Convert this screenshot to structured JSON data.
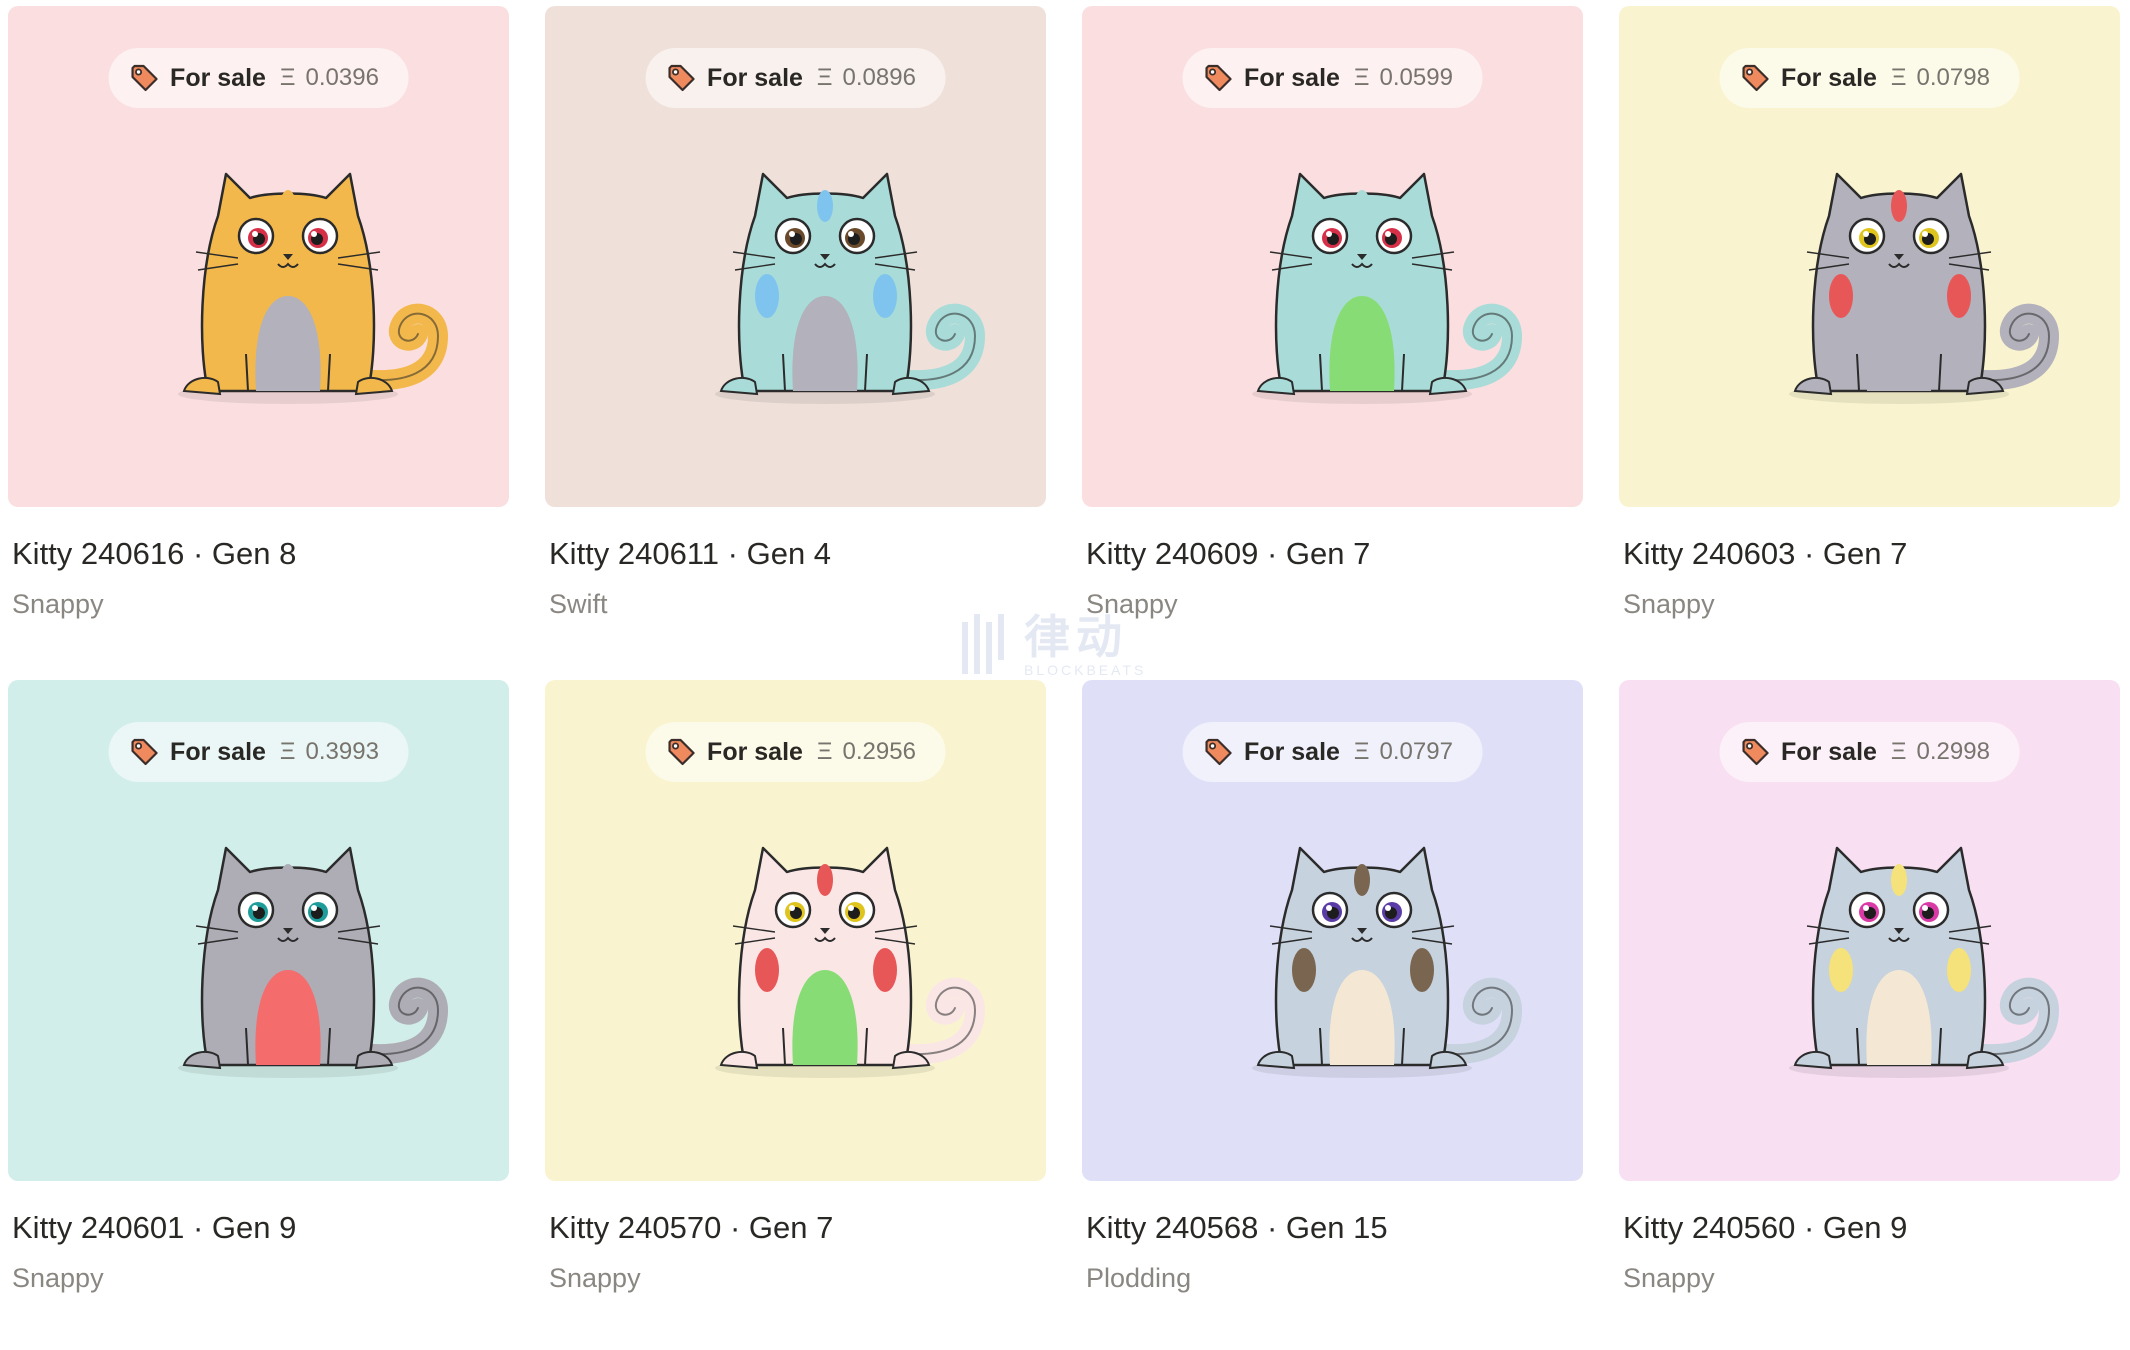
{
  "currency_symbol": "Ξ",
  "for_sale_label": "For sale",
  "watermark": {
    "text": "律动",
    "sub": "BLOCKBEATS"
  },
  "kitties": [
    {
      "title": "Kitty 240616 · Gen 8",
      "speed": "Snappy",
      "price": "0.0396",
      "bg": "#fbdfe0",
      "body": "#f3b84b",
      "belly": "#b3b1bb",
      "eyes": "#d63048",
      "pattern": "#f3b84b"
    },
    {
      "title": "Kitty 240611 · Gen 4",
      "speed": "Swift",
      "price": "0.0896",
      "bg": "#efe0da",
      "body": "#a9dcd8",
      "belly": "#b3b1bb",
      "eyes": "#6b4a2c",
      "pattern": "#7ec4ee"
    },
    {
      "title": "Kitty 240609 · Gen 7",
      "speed": "Snappy",
      "price": "0.0599",
      "bg": "#fbdfe0",
      "body": "#a9dcd8",
      "belly": "#88dc76",
      "eyes": "#d63048",
      "pattern": "#a9dcd8"
    },
    {
      "title": "Kitty 240603 · Gen 7",
      "speed": "Snappy",
      "price": "0.0798",
      "bg": "#f9f4cf",
      "body": "#b3b1bb",
      "belly": "#b3b1bb",
      "eyes": "#e0c41e",
      "pattern": "#e85757"
    },
    {
      "title": "Kitty 240601 · Gen 9",
      "speed": "Snappy",
      "price": "0.3993",
      "bg": "#d2eeea",
      "body": "#aeadb5",
      "belly": "#f56c6c",
      "eyes": "#1e9c99",
      "pattern": "#aeadb5"
    },
    {
      "title": "Kitty 240570 · Gen 7",
      "speed": "Snappy",
      "price": "0.2956",
      "bg": "#f9f4cf",
      "body": "#fbe6e6",
      "belly": "#88dc76",
      "eyes": "#e0c41e",
      "pattern": "#e85757"
    },
    {
      "title": "Kitty 240568 · Gen 15",
      "speed": "Plodding",
      "price": "0.0797",
      "bg": "#dfe0f8",
      "body": "#c6d2de",
      "belly": "#f4e8d4",
      "eyes": "#5b3ba6",
      "pattern": "#7a6650"
    },
    {
      "title": "Kitty 240560 · Gen 9",
      "speed": "Snappy",
      "price": "0.2998",
      "bg": "#f8dff2",
      "body": "#c6d2de",
      "belly": "#f4e8d4",
      "eyes": "#d93ba6",
      "pattern": "#f5e27a"
    }
  ]
}
